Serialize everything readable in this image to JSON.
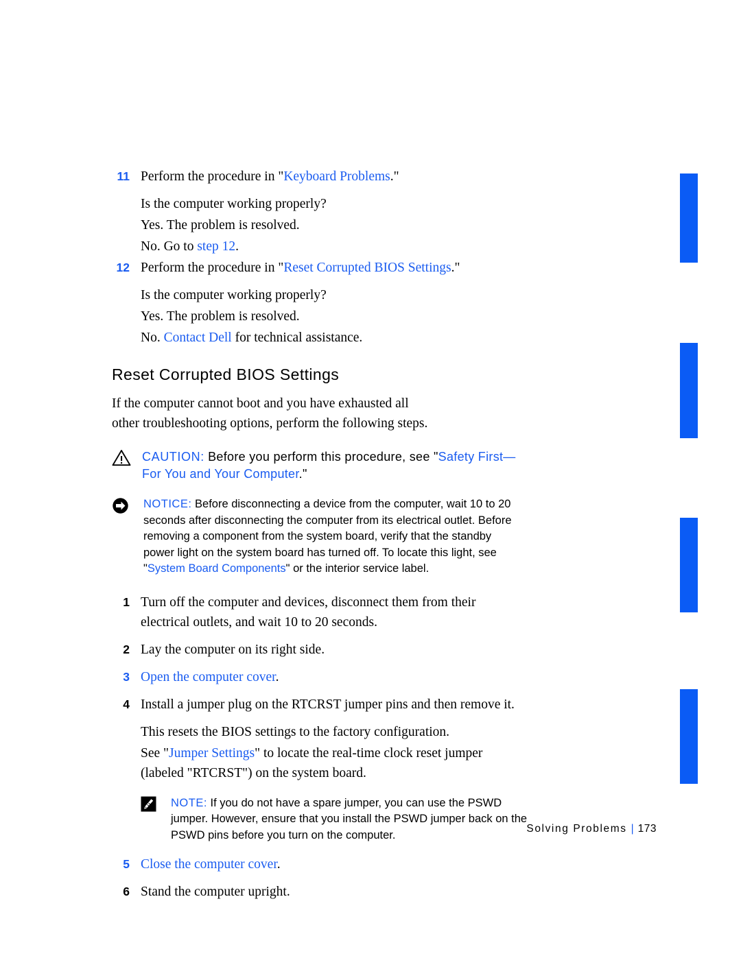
{
  "colors": {
    "link_blue": "#1a5cf0",
    "tab_blue": "#0a5bf5",
    "text_black": "#000000"
  },
  "steps_top": {
    "step11": {
      "number": "11",
      "text_before": "Perform the procedure in \"",
      "link": "Keyboard Problems",
      "text_after": ".\""
    },
    "q1": "Is the computer working properly?",
    "a1_yes": "Yes. The problem is resolved.",
    "a1_no_before": "No. Go to ",
    "a1_no_link": "step 12",
    "a1_no_after": ".",
    "step12": {
      "number": "12",
      "text_before": "Perform the procedure in \"",
      "link": "Reset Corrupted BIOS Settings",
      "text_after": ".\""
    },
    "q2": "Is the computer working properly?",
    "a2_yes": "Yes. The problem is resolved.",
    "a2_no_before": "No. ",
    "a2_no_link": "Contact Dell",
    "a2_no_after": " for technical assistance."
  },
  "section": {
    "heading": "Reset Corrupted BIOS Settings",
    "intro": "If the computer cannot boot and you have exhausted all other troubleshooting options, perform the following steps."
  },
  "caution": {
    "icon": "warning-triangle-icon",
    "label": "CAUTION:",
    "text_before": " Before you perform this procedure, see \"",
    "link": "Safety First—For You and Your Computer",
    "text_after": ".\""
  },
  "notice": {
    "icon": "circle-arrow-icon",
    "label": "NOTICE:",
    "text_before": " Before disconnecting a device from the computer, wait 10 to 20 seconds after disconnecting the computer from its electrical outlet. Before removing a component from the system board, verify that the standby power light on the system board has turned off. To locate this light, see \"",
    "link": "System Board Components",
    "text_after": "\" or the interior service label."
  },
  "note": {
    "icon": "pencil-note-icon",
    "label": "NOTE:",
    "text": " If you do not have a spare jumper, you can use the PSWD jumper. However, ensure that you install the PSWD jumper back on the PSWD pins before you turn on the computer."
  },
  "procedure": {
    "step1": {
      "number": "1",
      "text": "Turn off the computer and devices, disconnect them from their electrical outlets, and wait 10 to 20 seconds."
    },
    "step2": {
      "number": "2",
      "text": "Lay the computer on its right side."
    },
    "step3": {
      "number": "3",
      "link": "Open the computer cover",
      "text_after": "."
    },
    "step4": {
      "number": "4",
      "text": "Install a jumper plug on the RTCRST jumper pins and then remove it.",
      "sub1": "This resets the BIOS settings to the factory configuration.",
      "sub2_before": "See \"",
      "sub2_link": "Jumper Settings",
      "sub2_after": "\" to locate the real-time clock reset jumper (labeled \"RTCRST\") on the system board."
    },
    "step5": {
      "number": "5",
      "link": "Close the computer cover",
      "text_after": "."
    },
    "step6": {
      "number": "6",
      "text": "Stand the computer upright."
    }
  },
  "footer": {
    "chapter": "Solving Problems",
    "separator": "|",
    "page_number": "173"
  }
}
